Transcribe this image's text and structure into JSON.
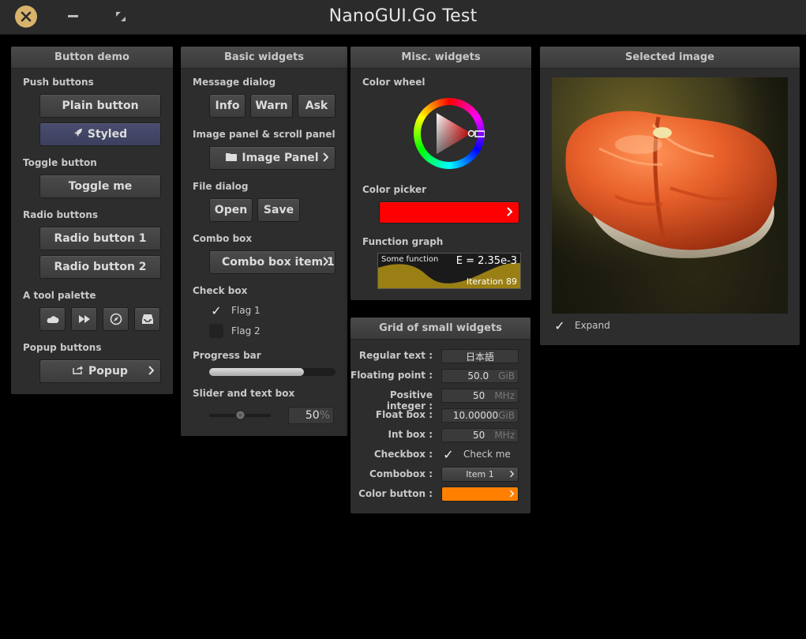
{
  "app": {
    "title": "NanoGUI.Go Test"
  },
  "button_demo": {
    "title": "Button demo",
    "push_label": "Push buttons",
    "plain": "Plain button",
    "styled": "Styled",
    "toggle_label": "Toggle button",
    "toggle": "Toggle me",
    "radio_label": "Radio buttons",
    "radio1": "Radio button 1",
    "radio2": "Radio button 2",
    "palette_label": "A tool palette",
    "tools": [
      "cloud-icon",
      "fast-forward-icon",
      "compass-icon",
      "inbox-icon"
    ],
    "popup_label": "Popup buttons",
    "popup": "Popup"
  },
  "basic": {
    "title": "Basic widgets",
    "msg_label": "Message dialog",
    "info": "Info",
    "warn": "Warn",
    "ask": "Ask",
    "image_label": "Image panel & scroll panel",
    "image_panel": "Image Panel",
    "file_label": "File dialog",
    "open": "Open",
    "save": "Save",
    "combo_label": "Combo box",
    "combo": "Combo box item 1",
    "check_label": "Check box",
    "flag1": "Flag 1",
    "flag2": "Flag 2",
    "progress_label": "Progress bar",
    "progress": 0.75,
    "slider_label": "Slider and text box",
    "slider_value": "50",
    "slider_unit": "%",
    "slider_fraction": 0.5
  },
  "misc": {
    "title": "Misc. widgets",
    "wheel_label": "Color wheel",
    "picker_label": "Color picker",
    "picker_color": "#ff0000",
    "graph_label": "Function graph",
    "graph_caption": "Some function",
    "graph_value": "E = 2.35e-3",
    "graph_footer": "Iteration 89"
  },
  "grid": {
    "title": "Grid of small widgets",
    "rows": [
      {
        "label": "Regular text :",
        "value": "日本語",
        "unit": ""
      },
      {
        "label": "Floating point :",
        "value": "50.0",
        "unit": "GiB"
      },
      {
        "label": "Positive integer :",
        "value": "50",
        "unit": "MHz"
      },
      {
        "label": "Float box :",
        "value": "10.00000",
        "unit": "GiB"
      },
      {
        "label": "Int box :",
        "value": "50",
        "unit": "MHz"
      }
    ],
    "checkbox_label": "Checkbox :",
    "checkbox_text": "Check me",
    "combobox_label": "Combobox :",
    "combobox_value": "Item 1",
    "color_label": "Color button :",
    "color_value": "#ff8000"
  },
  "image": {
    "title": "Selected image",
    "expand": "Expand"
  }
}
